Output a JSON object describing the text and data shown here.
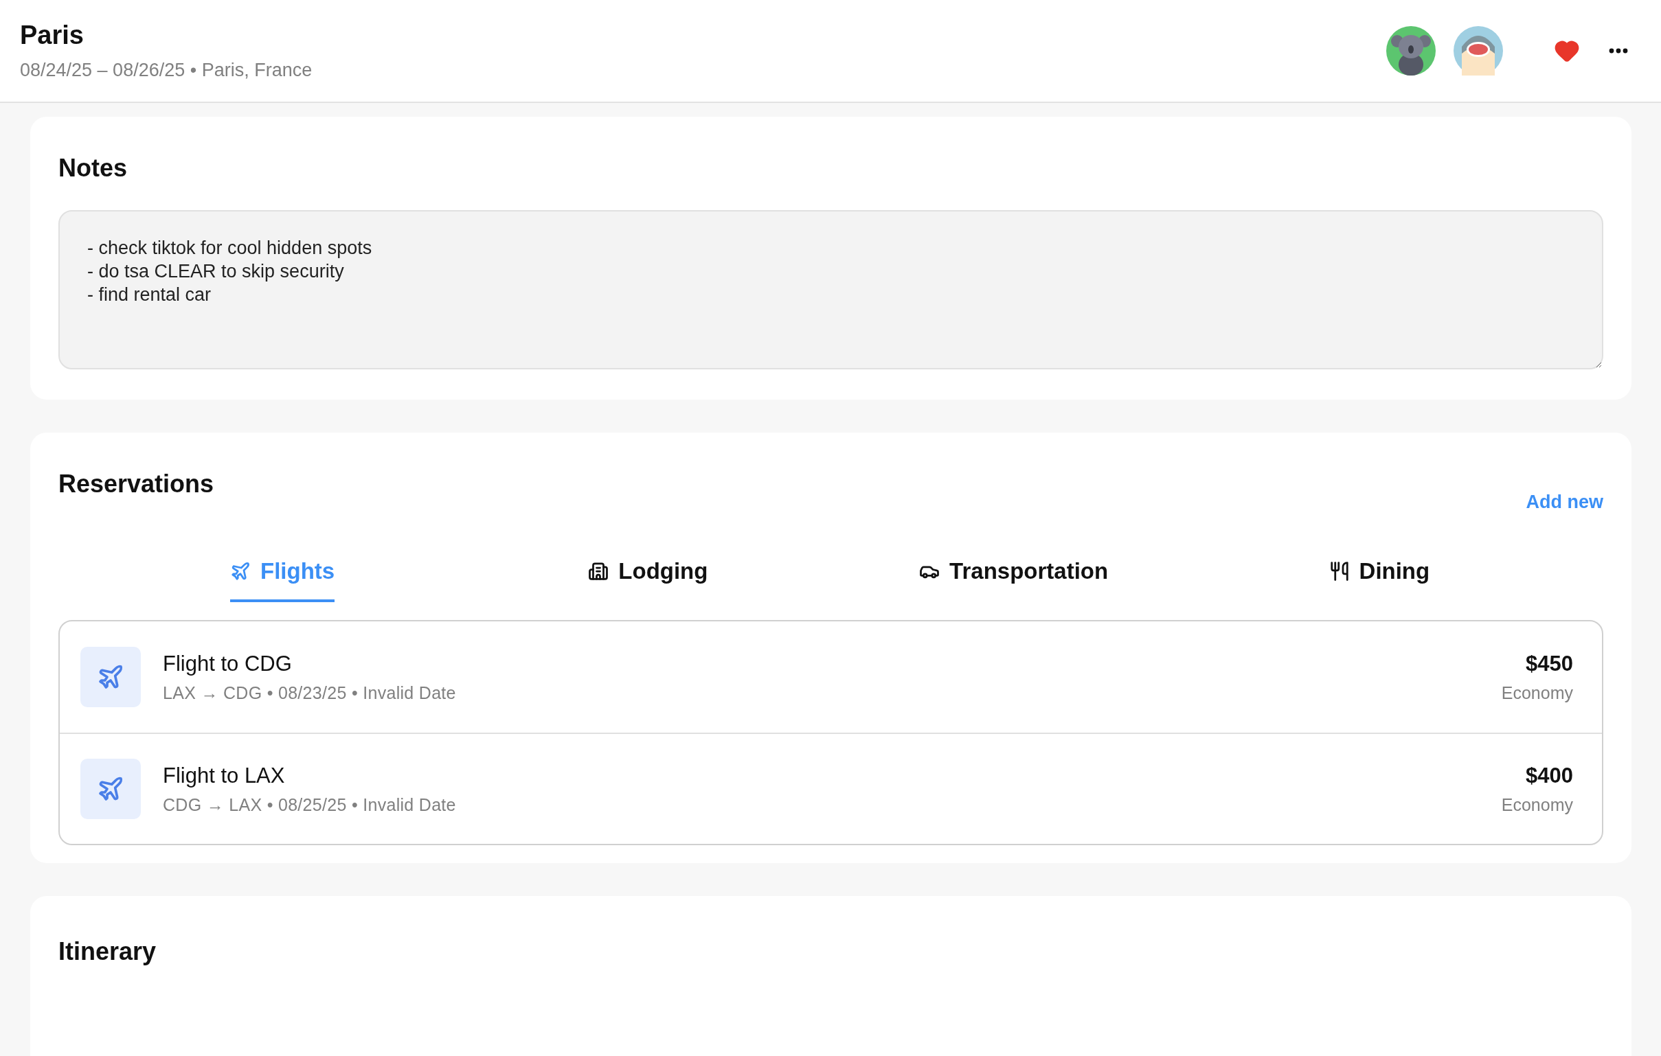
{
  "header": {
    "title": "Paris",
    "subtitle": "08/24/25 – 08/26/25 • Paris, France",
    "avatars": [
      {
        "kind": "koala"
      },
      {
        "kind": "shark"
      }
    ],
    "favorite": true
  },
  "notes": {
    "title": "Notes",
    "value": "- check tiktok for cool hidden spots\n- do tsa CLEAR to skip security\n- find rental car"
  },
  "reservations": {
    "title": "Reservations",
    "add_label": "Add new",
    "tabs": [
      {
        "label": "Flights",
        "kind": "plane",
        "selected": true
      },
      {
        "label": "Lodging",
        "kind": "building",
        "selected": false
      },
      {
        "label": "Transportation",
        "kind": "car",
        "selected": false
      },
      {
        "label": "Dining",
        "kind": "utensils",
        "selected": false
      }
    ],
    "items": [
      {
        "title": "Flight to CDG",
        "details": "LAX → CDG • 08/23/25 • Invalid Date",
        "price": "$450",
        "class": "Economy"
      },
      {
        "title": "Flight to LAX",
        "details": "CDG → LAX • 08/25/25 • Invalid Date",
        "price": "$400",
        "class": "Economy"
      }
    ]
  },
  "itinerary": {
    "title": "Itinerary"
  }
}
